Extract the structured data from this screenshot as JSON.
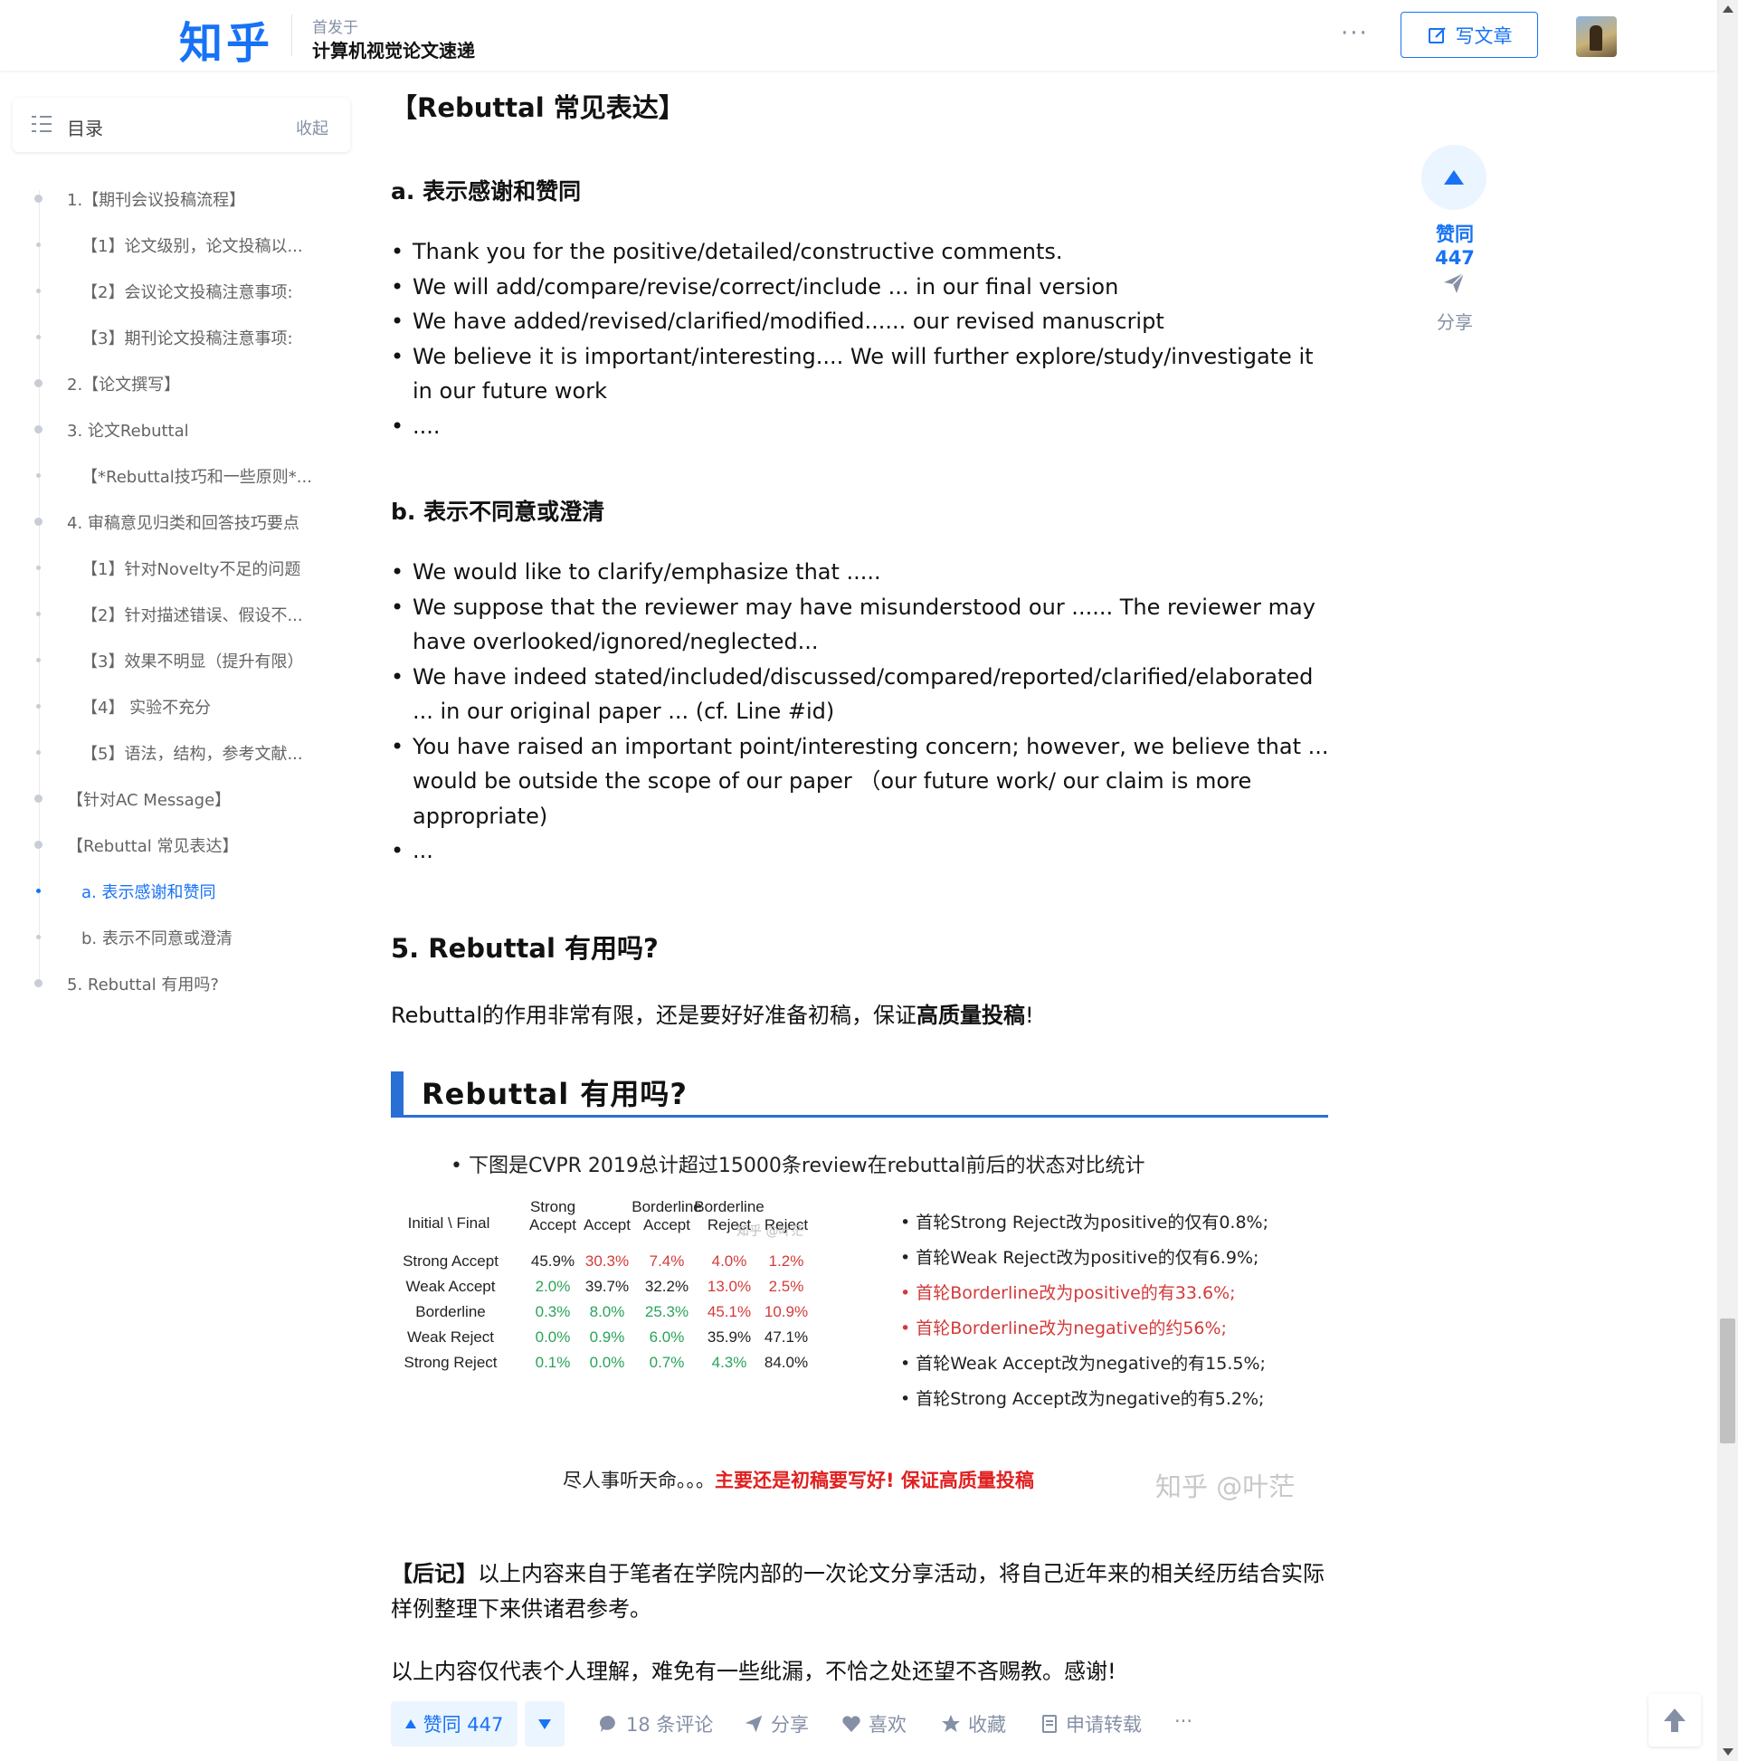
{
  "header": {
    "logo": "知乎",
    "published_in_label": "首发于",
    "column_name": "计算机视觉论文速递",
    "more_label": "···",
    "write_button_label": "写文章"
  },
  "toc": {
    "title": "目录",
    "collapse_label": "收起",
    "items": [
      {
        "label": "1.【期刊会议投稿流程】",
        "level": 1
      },
      {
        "label": "【1】论文级别，论文投稿以...",
        "level": 2
      },
      {
        "label": "【2】会议论文投稿注意事项:",
        "level": 2
      },
      {
        "label": "【3】期刊论文投稿注意事项:",
        "level": 2
      },
      {
        "label": "2.【论文撰写】",
        "level": 1
      },
      {
        "label": "3. 论文Rebuttal",
        "level": 1
      },
      {
        "label": "【*Rebuttal技巧和一些原则*...",
        "level": 2
      },
      {
        "label": "4. 审稿意见归类和回答技巧要点",
        "level": 1
      },
      {
        "label": "【1】针对Novelty不足的问题",
        "level": 2
      },
      {
        "label": "【2】针对描述错误、假设不...",
        "level": 2
      },
      {
        "label": "【3】效果不明显（提升有限）",
        "level": 2
      },
      {
        "label": "【4】 实验不充分",
        "level": 2
      },
      {
        "label": "【5】语法，结构，参考文献...",
        "level": 2
      },
      {
        "label": "【针对AC Message】",
        "level": 1
      },
      {
        "label": "【Rebuttal 常见表达】",
        "level": 1
      },
      {
        "label": "a. 表示感谢和赞同",
        "level": 2,
        "active": true
      },
      {
        "label": "b. 表示不同意或澄清",
        "level": 2
      },
      {
        "label": "5. Rebuttal 有用吗?",
        "level": 1
      }
    ]
  },
  "article": {
    "section_title": "【Rebuttal 常见表达】",
    "sub_a_title": "a. 表示感谢和赞同",
    "sub_a_bullets": [
      "Thank you for the positive/detailed/constructive comments.",
      "We will add/compare/revise/correct/include ... in our final version",
      "We have added/revised/clarified/modified...... our revised manuscript",
      "We believe it is important/interesting.... We will further explore/study/investigate it in our future work",
      "...."
    ],
    "sub_b_title": "b. 表示不同意或澄清",
    "sub_b_bullets": [
      "We would like to clarify/emphasize that .....",
      "We suppose that the reviewer may have misunderstood our ...... The reviewer may have overlooked/ignored/neglected...",
      "We have indeed stated/included/discussed/compared/reported/clarified/elaborated ... in our original paper ... (cf. Line #id)",
      "You have raised an important point/interesting concern; however, we believe that ... would be outside the scope of our paper （our future work/ our claim is more appropriate)",
      "..."
    ],
    "section5_title": "5. Rebuttal 有用吗?",
    "section5_para_prefix": "Rebuttal的作用非常有限，还是要好好准备初稿，保证",
    "section5_para_bold": "高质量投稿",
    "section5_para_suffix": "!",
    "afterword_label": "【后记】",
    "afterword_text": "以上内容来自于笔者在学院内部的一次论文分享活动，将自己近年来的相关经历结合实际样例整理下来供诸君参考。",
    "closing_text": "以上内容仅代表个人理解，难免有一些纰漏，不恰之处还望不吝赐教。感谢!"
  },
  "slide": {
    "title": "Rebuttal 有用吗?",
    "intro": "• 下图是CVPR 2019总计超过15000条review在rebuttal前后的状态对比统计",
    "corner_label": "Initial \\ Final",
    "col_headers": [
      [
        "Strong",
        "Accept"
      ],
      [
        "",
        "Accept"
      ],
      [
        "Borderline",
        "Accept"
      ],
      [
        "Borderline",
        "Reject"
      ],
      [
        "",
        "Reject"
      ]
    ],
    "rows": [
      {
        "label": "Strong Accept",
        "values": [
          "45.9%",
          "30.3%",
          "7.4%",
          "4.0%",
          "1.2%"
        ],
        "colors": [
          "k",
          "r",
          "r",
          "r",
          "r"
        ]
      },
      {
        "label": "Weak Accept",
        "values": [
          "2.0%",
          "39.7%",
          "32.2%",
          "13.0%",
          "2.5%"
        ],
        "colors": [
          "g",
          "k",
          "k",
          "r",
          "r"
        ]
      },
      {
        "label": "Borderline",
        "values": [
          "0.3%",
          "8.0%",
          "25.3%",
          "45.1%",
          "10.9%"
        ],
        "colors": [
          "g",
          "g",
          "g",
          "r",
          "r"
        ]
      },
      {
        "label": "Weak Reject",
        "values": [
          "0.0%",
          "0.9%",
          "6.0%",
          "35.9%",
          "47.1%"
        ],
        "colors": [
          "g",
          "g",
          "g",
          "k",
          "k"
        ]
      },
      {
        "label": "Strong Reject",
        "values": [
          "0.1%",
          "0.0%",
          "0.7%",
          "4.3%",
          "84.0%"
        ],
        "colors": [
          "g",
          "g",
          "g",
          "g",
          "k"
        ]
      }
    ],
    "table_watermark": "知乎 @叶茫",
    "notes": [
      {
        "text": "• 首轮Strong Reject改为positive的仅有0.8%;",
        "red": false
      },
      {
        "text": "• 首轮Weak Reject改为positive的仅有6.9%;",
        "red": false
      },
      {
        "text": "• 首轮Borderline改为positive的有33.6%;",
        "red": true
      },
      {
        "text": "• 首轮Borderline改为negative的约56%;",
        "red": true
      },
      {
        "text": "• 首轮Weak Accept改为negative的有15.5%;",
        "red": false
      },
      {
        "text": "• 首轮Strong Accept改为negative的有5.2%;",
        "red": false
      }
    ],
    "caption_plain": "尽人事听天命。。。",
    "caption_red": "主要还是初稿要写好! 保证高质量投稿",
    "watermark": "知乎 @叶茫"
  },
  "side_rail": {
    "vote_label": "赞同 447",
    "share_label": "分享"
  },
  "action_bar": {
    "vote_label": "赞同 447",
    "comments_label": "18 条评论",
    "share_label": "分享",
    "like_label": "喜欢",
    "favorite_label": "收藏",
    "repost_label": "申请转载",
    "more_label": "···"
  },
  "colors": {
    "brand_blue": "#1772f6",
    "muted_gray": "#8590a6",
    "table_red": "#d43a3a",
    "table_green": "#2aa35a",
    "slide_accent": "#2a6fd6"
  },
  "icons": [
    "toc-list-icon",
    "edit-icon",
    "paper-plane-icon",
    "comment-icon",
    "heart-icon",
    "star-icon",
    "document-icon",
    "back-to-top-icon"
  ]
}
